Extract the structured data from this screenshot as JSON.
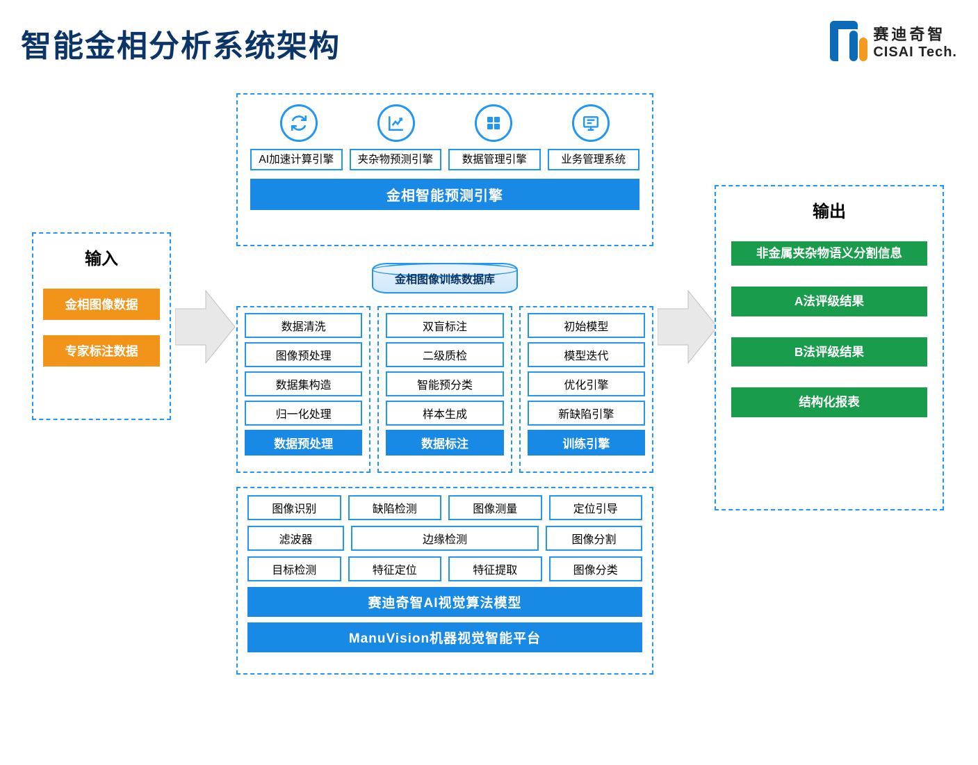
{
  "header": {
    "title": "智能金相分析系统架构",
    "logo_cn": "赛迪奇智",
    "logo_en": "CISAI Tech."
  },
  "input": {
    "title": "输入",
    "items": [
      "金相图像数据",
      "专家标注数据"
    ]
  },
  "engine": {
    "icons": [
      "refresh-icon",
      "chart-up-icon",
      "grid-icon",
      "monitor-icon"
    ],
    "labels": [
      "AI加速计算引擎",
      "夹杂物预测引擎",
      "数据管理引擎",
      "业务管理系统"
    ],
    "bar": "金相智能预测引擎"
  },
  "database": "金相图像训练数据库",
  "columns": [
    {
      "items": [
        "数据清洗",
        "图像预处理",
        "数据集构造",
        "归一化处理"
      ],
      "footer": "数据预处理"
    },
    {
      "items": [
        "双盲标注",
        "二级质检",
        "智能预分类",
        "样本生成"
      ],
      "footer": "数据标注"
    },
    {
      "items": [
        "初始模型",
        "模型迭代",
        "优化引擎",
        "新缺陷引擎"
      ],
      "footer": "训练引擎"
    }
  ],
  "platform": {
    "row1": [
      "图像识别",
      "缺陷检测",
      "图像测量",
      "定位引导"
    ],
    "row2_left": "滤波器",
    "row2_mid": "边缘检测",
    "row2_right": "图像分割",
    "row3": [
      "目标检测",
      "特征定位",
      "特征提取",
      "图像分类"
    ],
    "bar1": "赛迪奇智AI视觉算法模型",
    "bar2": "ManuVision机器视觉智能平台"
  },
  "output": {
    "title": "输出",
    "items": [
      "非金属夹杂物语义分割信息",
      "A法评级结果",
      "B法评级结果",
      "结构化报表"
    ]
  }
}
